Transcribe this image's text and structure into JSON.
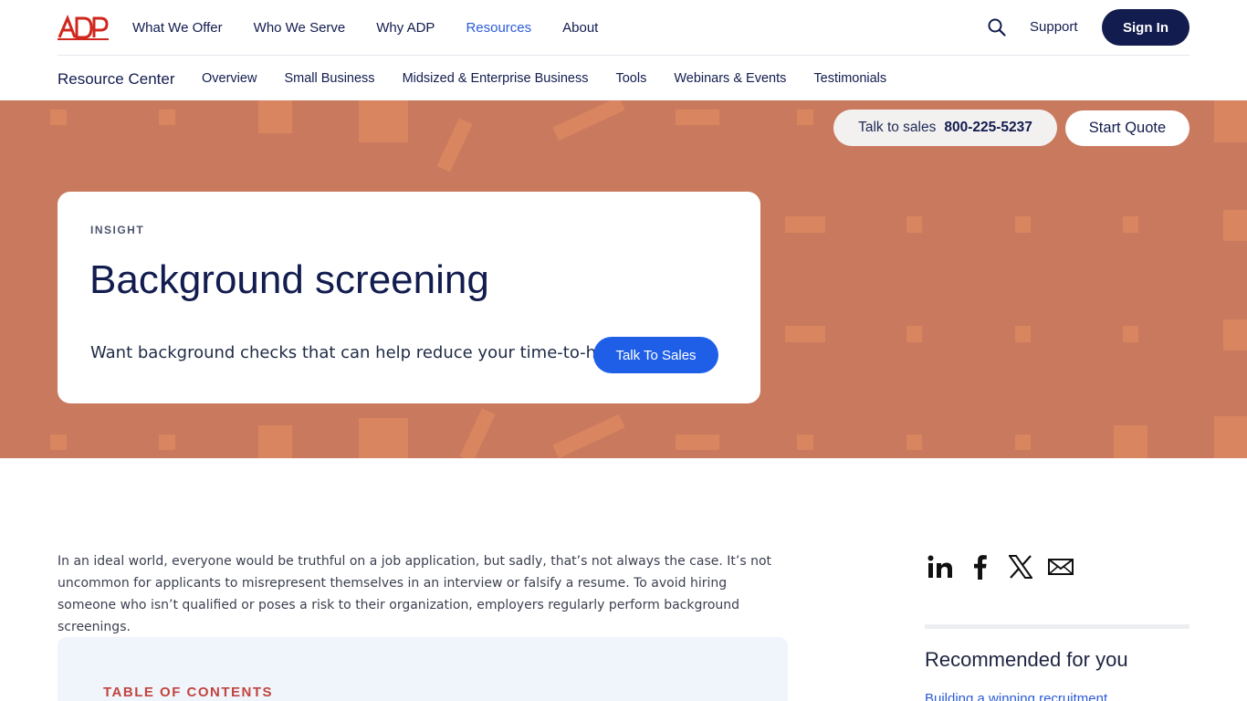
{
  "header": {
    "brand": "ADP",
    "nav": [
      {
        "label": "What We Offer",
        "active": false
      },
      {
        "label": "Who We Serve",
        "active": false
      },
      {
        "label": "Why ADP",
        "active": false
      },
      {
        "label": "Resources",
        "active": true
      },
      {
        "label": "About",
        "active": false
      }
    ],
    "search_icon": "search-icon",
    "support_label": "Support",
    "signin_label": "Sign In"
  },
  "subnav": {
    "title": "Resource Center",
    "items": [
      "Overview",
      "Small Business",
      "Midsized & Enterprise Business",
      "Tools",
      "Webinars & Events",
      "Testimonials"
    ]
  },
  "hero": {
    "talk_label": "Talk to sales",
    "phone": "800-225-5237",
    "quote_label": "Start Quote",
    "eyebrow": "INSIGHT",
    "title": "Background screening",
    "subtitle": "Want background checks that can help reduce your time-to-hire?",
    "cta_label": "Talk To Sales",
    "bg_color": "#c97a5e",
    "pattern_color": "#d98560"
  },
  "article": {
    "intro": "In an ideal world, everyone would be truthful on a job application, but sadly, that’s not always the case. It’s not uncommon for applicants to misrepresent themselves in an interview or falsify a resume. To avoid hiring someone who isn’t qualified or poses a risk to their organization, employers regularly perform background screenings.",
    "toc_title": "TABLE OF CONTENTS"
  },
  "sidebar": {
    "share_icons": [
      "linkedin-icon",
      "facebook-icon",
      "x-icon",
      "email-icon"
    ],
    "recommended_title": "Recommended for you",
    "recommended_links": [
      "Building a winning recruitment"
    ]
  },
  "colors": {
    "navy": "#121c4e",
    "accent_blue": "#1f5fe8",
    "link_blue": "#2b5bd7",
    "brand_red": "#d0271d",
    "toc_red": "#c0453f"
  }
}
